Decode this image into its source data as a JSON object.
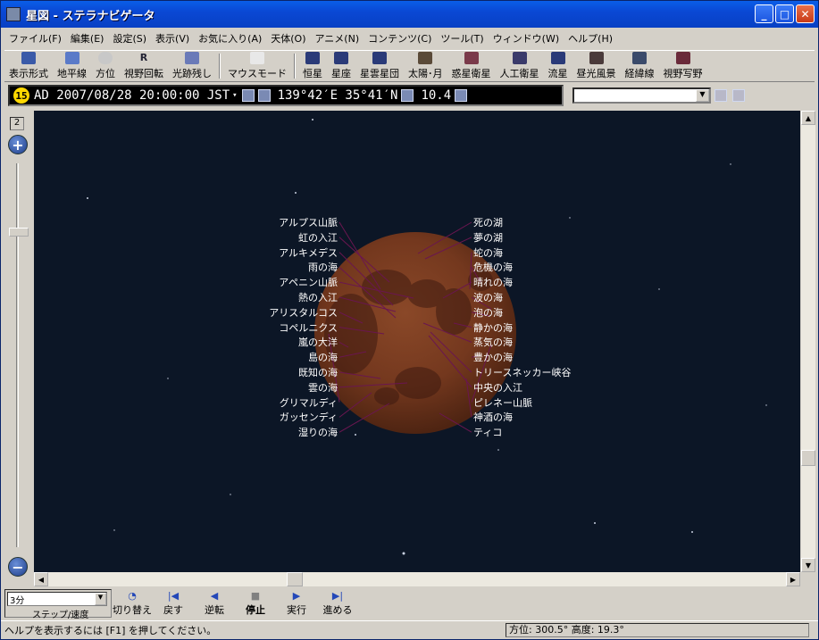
{
  "window": {
    "title": "星図 - ステラナビゲータ"
  },
  "menu": [
    "ファイル(F)",
    "編集(E)",
    "設定(S)",
    "表示(V)",
    "お気に入り(A)",
    "天体(O)",
    "アニメ(N)",
    "コンテンツ(C)",
    "ツール(T)",
    "ウィンドウ(W)",
    "ヘルプ(H)"
  ],
  "toolbar": {
    "display_mode": "表示形式",
    "horizon": "地平線",
    "direction": "方位",
    "view_rotate": "視野回転",
    "trail": "光跡残し",
    "mouse_mode": "マウスモード",
    "stars": "恒星",
    "constellations": "星座",
    "nebulae": "星雲星団",
    "sun_moon": "太陽･月",
    "planets": "惑星衛星",
    "satellites": "人工衛星",
    "meteors": "流星",
    "scenery": "昼光風景",
    "grid": "経緯線",
    "fov": "視野写野"
  },
  "info": {
    "day_badge": "15",
    "datetime": "AD 2007/08/28 20:00:00 JST",
    "location": "139°42′E 35°41′N",
    "zoom": "10.4"
  },
  "zoom": {
    "level": "2",
    "in": "+",
    "out": "−"
  },
  "moon_labels": {
    "left": [
      "アルプス山脈",
      "虹の入江",
      "アルキメデス",
      "雨の海",
      "アペニン山脈",
      "熱の入江",
      "アリスタルコス",
      "コペルニクス",
      "嵐の大洋",
      "島の海",
      "既知の海",
      "雲の海",
      "グリマルディ",
      "ガッセンディ",
      "湿りの海"
    ],
    "right": [
      "死の湖",
      "夢の湖",
      "蛇の海",
      "危機の海",
      "晴れの海",
      "波の海",
      "泡の海",
      "静かの海",
      "蒸気の海",
      "豊かの海",
      "トリースネッカー峡谷",
      "中央の入江",
      "ピレネー山脈",
      "神酒の海",
      "ティコ"
    ]
  },
  "playback": {
    "step_value": "3分",
    "step_label": "ステップ/速度",
    "switch": "切り替え",
    "back": "戻す",
    "reverse": "逆転",
    "stop": "停止",
    "run": "実行",
    "forward": "進める"
  },
  "status": {
    "help": "ヘルプを表示するには [F1] を押してください。",
    "position": "方位: 300.5°  高度:  19.3°"
  },
  "colors": {
    "sky": "#0c1626",
    "moon": "#7a3a20",
    "titlebar": "#0a48d4"
  }
}
